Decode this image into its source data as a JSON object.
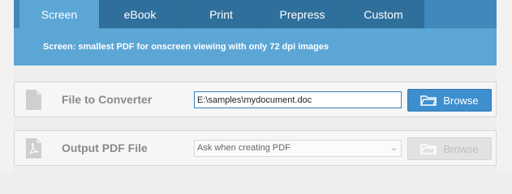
{
  "tabs": [
    {
      "label": "Screen",
      "active": true
    },
    {
      "label": "eBook",
      "active": false
    },
    {
      "label": "Print",
      "active": false
    },
    {
      "label": "Prepress",
      "active": false
    },
    {
      "label": "Custom",
      "active": false
    }
  ],
  "description": "Screen: smallest PDF for onscreen viewing with only 72 dpi images",
  "input_row": {
    "label": "File to Converter",
    "value": "E:\\samples\\mydocument.doc",
    "button": "Browse",
    "icon": "document-icon"
  },
  "output_row": {
    "label": "Output PDF File",
    "value": "Ask when creating PDF",
    "button": "Browse",
    "icon": "pdf-document-icon"
  },
  "colors": {
    "tab_bar": "#2f6f9c",
    "active_tab": "#5ca6d6",
    "button_blue": "#3d8fce"
  }
}
